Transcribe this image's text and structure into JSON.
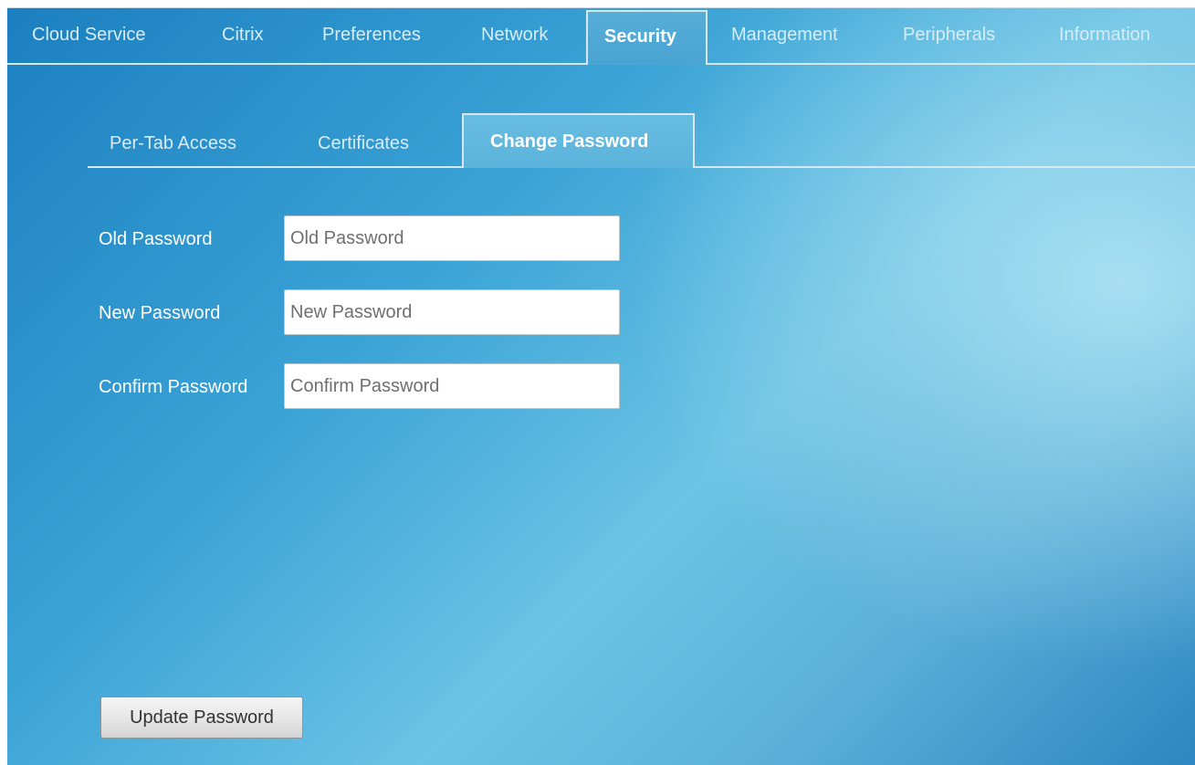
{
  "top_nav": {
    "tabs": [
      {
        "label": "Cloud Service"
      },
      {
        "label": "Citrix"
      },
      {
        "label": "Preferences"
      },
      {
        "label": "Network"
      },
      {
        "label": "Security",
        "active": true
      },
      {
        "label": "Management"
      },
      {
        "label": "Peripherals"
      },
      {
        "label": "Information"
      }
    ]
  },
  "sub_nav": {
    "tabs": [
      {
        "label": "Per-Tab Access"
      },
      {
        "label": "Certificates"
      },
      {
        "label": "Change Password",
        "active": true
      }
    ]
  },
  "form": {
    "old_password": {
      "label": "Old Password",
      "placeholder": "Old Password",
      "value": ""
    },
    "new_password": {
      "label": "New Password",
      "placeholder": "New Password",
      "value": ""
    },
    "confirm_password": {
      "label": "Confirm Password",
      "placeholder": "Confirm Password",
      "value": ""
    },
    "submit_label": "Update Password"
  },
  "colors": {
    "background_dark": "#1c7fc0",
    "background_light": "#a9dff1",
    "tab_border": "#d8e8ef",
    "inactive_tab_text": "#d6ecf6",
    "active_tab_text": "#ffffff"
  }
}
